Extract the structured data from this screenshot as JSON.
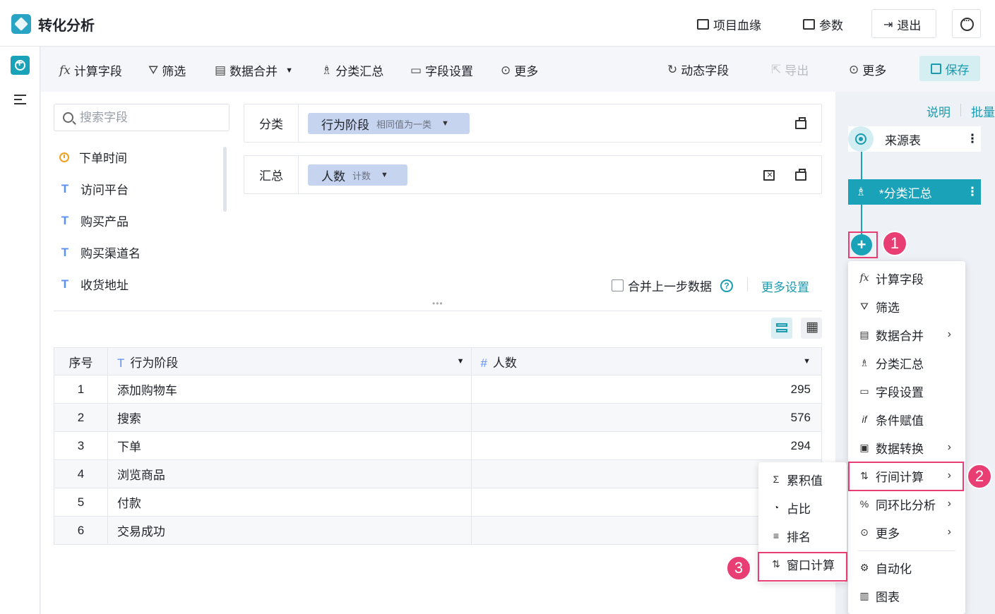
{
  "app": {
    "title": "转化分析"
  },
  "top_actions": {
    "lineage": "项目血缘",
    "params": "参数",
    "logout": "退出"
  },
  "toolbar": {
    "calc_field": "计算字段",
    "filter": "筛选",
    "merge": "数据合并",
    "group_summary": "分类汇总",
    "field_settings": "字段设置",
    "more": "更多",
    "dynamic_field": "动态字段",
    "export": "导出",
    "more_right": "更多",
    "save": "保存"
  },
  "search": {
    "placeholder": "搜索字段"
  },
  "fields": [
    {
      "name": "下单时间",
      "type": "date"
    },
    {
      "name": "访问平台",
      "type": "text"
    },
    {
      "name": "购买产品",
      "type": "text"
    },
    {
      "name": "购买渠道名",
      "type": "text"
    },
    {
      "name": "收货地址",
      "type": "text"
    }
  ],
  "config": {
    "category_label": "分类",
    "category_chip": "行为阶段",
    "category_chip_sub": "相同值为一类",
    "summary_label": "汇总",
    "summary_chip": "人数",
    "summary_chip_sub": "计数",
    "merge_prev": "合并上一步数据",
    "more_settings": "更多设置"
  },
  "table": {
    "headers": {
      "index": "序号",
      "stage": "行为阶段",
      "count": "人数"
    },
    "rows": [
      {
        "index": "1",
        "stage": "添加购物车",
        "count": "295"
      },
      {
        "index": "2",
        "stage": "搜索",
        "count": "576"
      },
      {
        "index": "3",
        "stage": "下单",
        "count": "294"
      },
      {
        "index": "4",
        "stage": "浏览商品",
        "count": ""
      },
      {
        "index": "5",
        "stage": "付款",
        "count": ""
      },
      {
        "index": "6",
        "stage": "交易成功",
        "count": ""
      }
    ]
  },
  "flow": {
    "links": {
      "explain": "说明",
      "batch": "批量"
    },
    "source_node": "来源表",
    "active_node": "*分类汇总"
  },
  "menu": {
    "items": [
      {
        "label": "计算字段",
        "icon": "fx-icon",
        "arrow": false
      },
      {
        "label": "筛选",
        "icon": "filter-icon",
        "arrow": false
      },
      {
        "label": "数据合并",
        "icon": "merge-icon",
        "arrow": true
      },
      {
        "label": "分类汇总",
        "icon": "group-icon",
        "arrow": false
      },
      {
        "label": "字段设置",
        "icon": "field-settings-icon",
        "arrow": false
      },
      {
        "label": "条件赋值",
        "icon": "condition-icon",
        "arrow": false
      },
      {
        "label": "数据转换",
        "icon": "transform-icon",
        "arrow": true
      },
      {
        "label": "行间计算",
        "icon": "row-calc-icon",
        "arrow": true
      },
      {
        "label": "同环比分析",
        "icon": "percent-icon",
        "arrow": true
      },
      {
        "label": "更多",
        "icon": "more-icon",
        "arrow": true
      },
      {
        "label": "自动化",
        "icon": "automation-icon",
        "arrow": false
      },
      {
        "label": "图表",
        "icon": "chart-icon",
        "arrow": false
      }
    ]
  },
  "submenu": {
    "items": [
      {
        "label": "累积值"
      },
      {
        "label": "占比"
      },
      {
        "label": "排名"
      },
      {
        "label": "窗口计算"
      }
    ]
  },
  "annotations": {
    "step1": "1",
    "step2": "2",
    "step3": "3"
  },
  "colors": {
    "accent": "#1aa3b8",
    "highlight": "#e83e74",
    "chip": "#c6d4f0",
    "field_icon": "#5b8ff9"
  }
}
